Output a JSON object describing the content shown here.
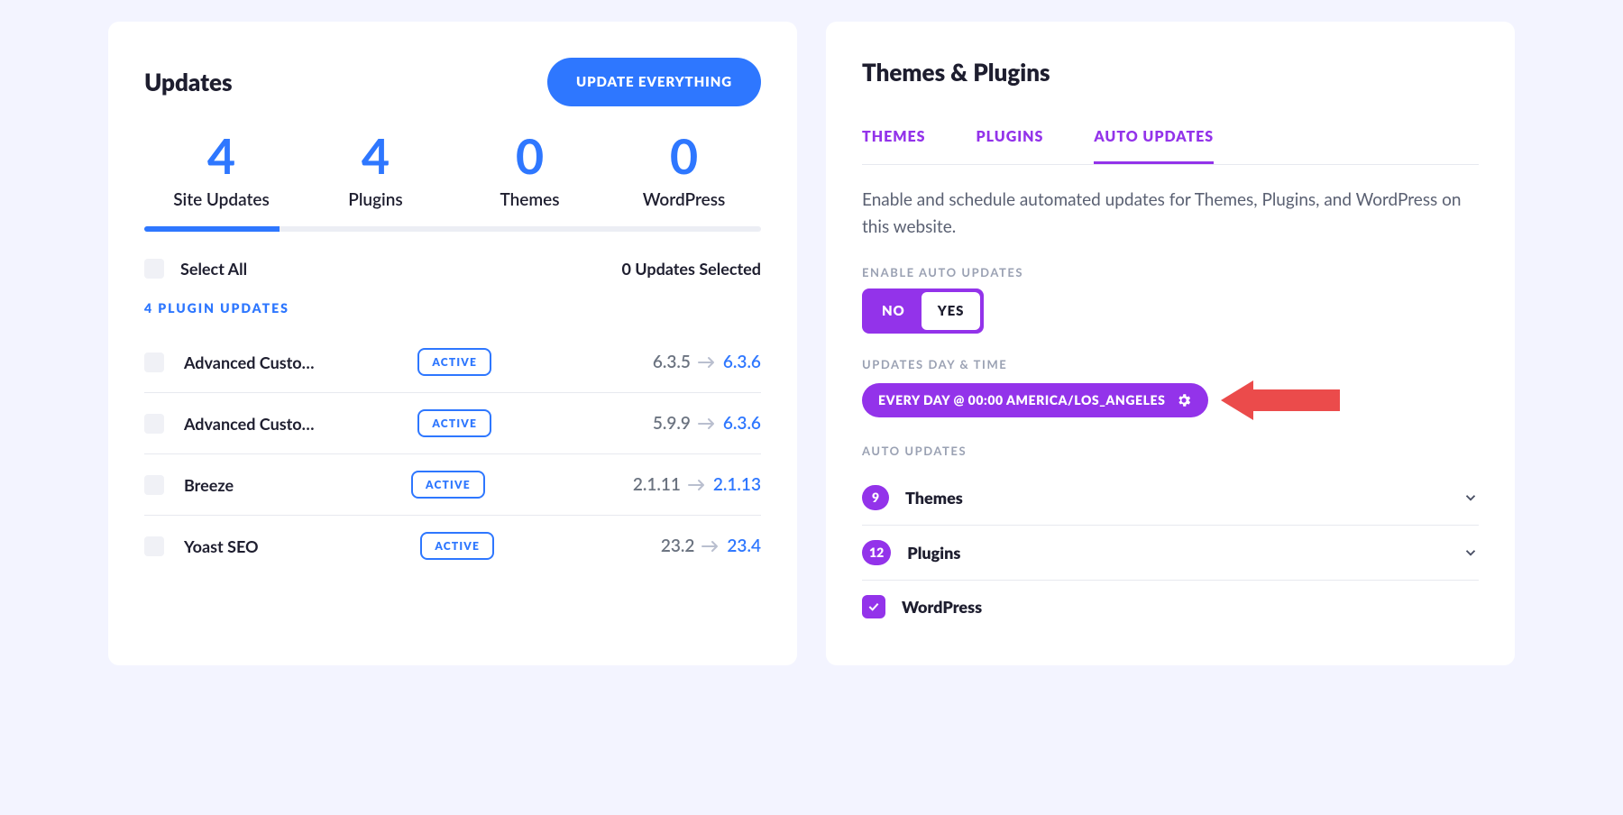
{
  "updates": {
    "title": "Updates",
    "update_all_label": "UPDATE EVERYTHING",
    "stats": [
      {
        "value": "4",
        "label": "Site Updates"
      },
      {
        "value": "4",
        "label": "Plugins"
      },
      {
        "value": "0",
        "label": "Themes"
      },
      {
        "value": "0",
        "label": "WordPress"
      }
    ],
    "select_all_label": "Select All",
    "selected_label": "0 Updates Selected",
    "plugin_section_label": "4 PLUGIN UPDATES",
    "active_badge": "ACTIVE",
    "rows": [
      {
        "name": "Advanced Custo…",
        "from": "6.3.5",
        "to": "6.3.6"
      },
      {
        "name": "Advanced Custo…",
        "from": "5.9.9",
        "to": "6.3.6"
      },
      {
        "name": "Breeze",
        "from": "2.1.11",
        "to": "2.1.13"
      },
      {
        "name": "Yoast SEO",
        "from": "23.2",
        "to": "23.4"
      }
    ]
  },
  "themesPlugins": {
    "title": "Themes & Plugins",
    "tabs": {
      "themes": "THEMES",
      "plugins": "PLUGINS",
      "auto": "AUTO UPDATES"
    },
    "description": "Enable and schedule automated updates for Themes, Plugins, and WordPress on this website.",
    "enable_label": "ENABLE AUTO UPDATES",
    "toggle": {
      "no": "NO",
      "yes": "YES"
    },
    "schedule_label": "UPDATES DAY & TIME",
    "schedule_value": "EVERY DAY  @ 00:00  AMERICA/LOS_ANGELES",
    "auto_label": "AUTO UPDATES",
    "items": [
      {
        "count": "9",
        "label": "Themes",
        "expandable": true
      },
      {
        "count": "12",
        "label": "Plugins",
        "expandable": true
      },
      {
        "checked": true,
        "label": "WordPress",
        "expandable": false
      }
    ]
  }
}
